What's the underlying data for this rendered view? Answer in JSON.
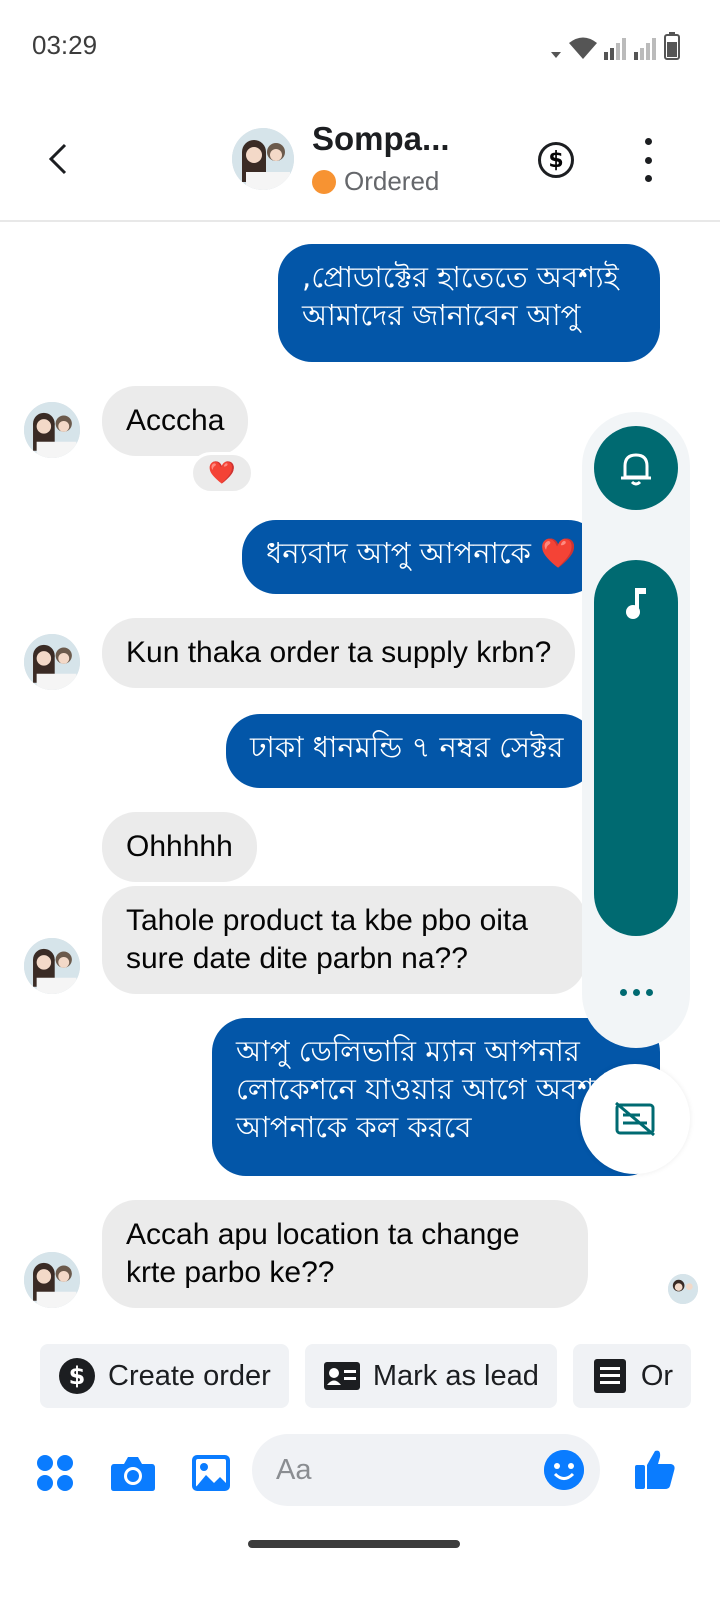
{
  "status_bar": {
    "time": "03:29"
  },
  "header": {
    "contact_name": "Sompa...",
    "status_label": "Ordered",
    "status_color": "#f79332"
  },
  "colors": {
    "outgoing_bubble": "#0356a8",
    "incoming_bubble": "#ebebeb",
    "panel_accent": "#006a71",
    "messenger_blue": "#0a7cff"
  },
  "messages": [
    {
      "direction": "outgoing",
      "text": ",প্রোডাক্টের হাতেতে অবশ্যই আমাদের জানাবেন আপু"
    },
    {
      "direction": "incoming",
      "text": "Acccha",
      "reaction": "❤️"
    },
    {
      "direction": "outgoing",
      "text": "ধন্যবাদ আপু আপনাকে ❤️"
    },
    {
      "direction": "incoming",
      "text": "Kun thaka order ta supply krbn?"
    },
    {
      "direction": "outgoing",
      "text": "ঢাকা ধানমন্ডি ৭ নম্বর সেক্টর"
    },
    {
      "direction": "incoming",
      "text": "Ohhhhh"
    },
    {
      "direction": "incoming",
      "text": "Tahole product ta kbe pbo oita sure date dite parbn na??"
    },
    {
      "direction": "outgoing",
      "text": "আপু ডেলিভারি ম্যান আপনার লোকেশনে যাওয়ার আগে অবশ্যই আপনাকে কল করবে"
    },
    {
      "direction": "incoming",
      "text": "Accah apu location ta change krte parbo ke??"
    }
  ],
  "floating_panel": {
    "icons": [
      "bell-icon",
      "music-note-icon",
      "more-dots-icon",
      "caption-off-icon"
    ]
  },
  "quick_actions": [
    {
      "label": "Create order",
      "icon": "dollar-circle-icon"
    },
    {
      "label": "Mark as lead",
      "icon": "contact-card-icon"
    },
    {
      "label": "Or",
      "icon": "list-document-icon"
    }
  ],
  "composer": {
    "placeholder": "Aa",
    "icons": [
      "apps-grid-icon",
      "camera-icon",
      "gallery-icon",
      "emoji-icon",
      "thumbs-up-icon"
    ]
  }
}
